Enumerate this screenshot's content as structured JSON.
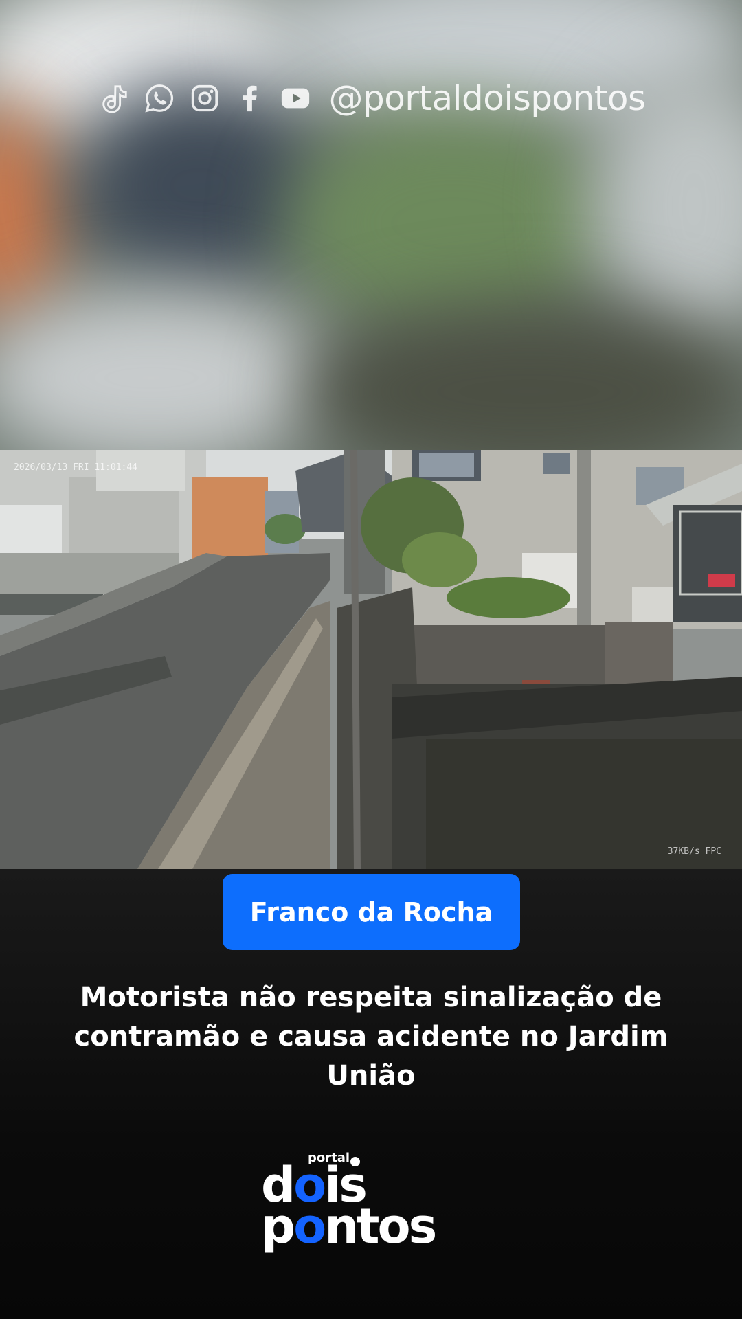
{
  "social": {
    "icons": [
      "tiktok-icon",
      "whatsapp-icon",
      "instagram-icon",
      "facebook-icon",
      "youtube-icon"
    ],
    "handle": "@portaldoispontos"
  },
  "video": {
    "timestamp": "2026/03/13 FRI 11:01:44",
    "bitrate": "37KB/s FPC"
  },
  "badge": {
    "label": "Franco da Rocha",
    "color": "#0d6efd"
  },
  "headline": "Motorista não respeita sinalização de contramão e causa acidente no Jardim União",
  "logo": {
    "portal": "portal",
    "line1_a": "d",
    "line1_o": "o",
    "line1_b": "is",
    "line2_a": "p",
    "line2_o": "o",
    "line2_b": "ntos",
    "accent": "#1463ff"
  }
}
